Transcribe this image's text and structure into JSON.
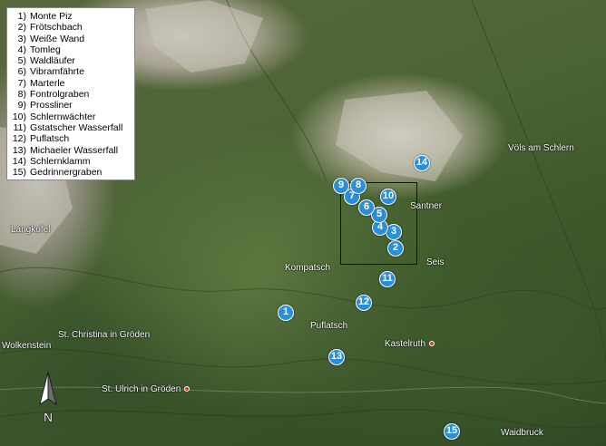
{
  "legend": [
    {
      "num": "1)",
      "name": "Monte Piz"
    },
    {
      "num": "2)",
      "name": "Frötschbach"
    },
    {
      "num": "3)",
      "name": "Weiße Wand"
    },
    {
      "num": "4)",
      "name": "Tomleg"
    },
    {
      "num": "5)",
      "name": "Waldläufer"
    },
    {
      "num": "6)",
      "name": "Vibramfährte"
    },
    {
      "num": "7)",
      "name": "Marterle"
    },
    {
      "num": "8)",
      "name": "Fontrolgraben"
    },
    {
      "num": "9)",
      "name": "Prossliner"
    },
    {
      "num": "10)",
      "name": "Schlernwächter"
    },
    {
      "num": "11)",
      "name": "Gstatscher Wasserfall"
    },
    {
      "num": "12)",
      "name": "Puflatsch"
    },
    {
      "num": "13)",
      "name": "Michaeler Wasserfall"
    },
    {
      "num": "14)",
      "name": "Schlernklamm"
    },
    {
      "num": "15)",
      "name": "Gedrinnergraben"
    }
  ],
  "markers": [
    "1",
    "2",
    "3",
    "4",
    "5",
    "6",
    "7",
    "8",
    "9",
    "10",
    "11",
    "12",
    "13",
    "14",
    "15"
  ],
  "places": {
    "langkofel": "Langkofel",
    "voels": "Völs am Schlern",
    "santner": "Santner",
    "seis": "Seis",
    "kompatsch": "Kompatsch",
    "puflatsch": "Puflatsch",
    "st_christina": "St. Christina in Gröden",
    "wolkenstein": "Wolkenstein",
    "kastelruth": "Kastelruth",
    "st_ulrich": "St. Ulrich in Gröden",
    "waidbruck": "Waidbruck"
  },
  "compass_label": "N",
  "colors": {
    "marker": "#2b8fd8",
    "town_dot": "#e03c2c"
  }
}
